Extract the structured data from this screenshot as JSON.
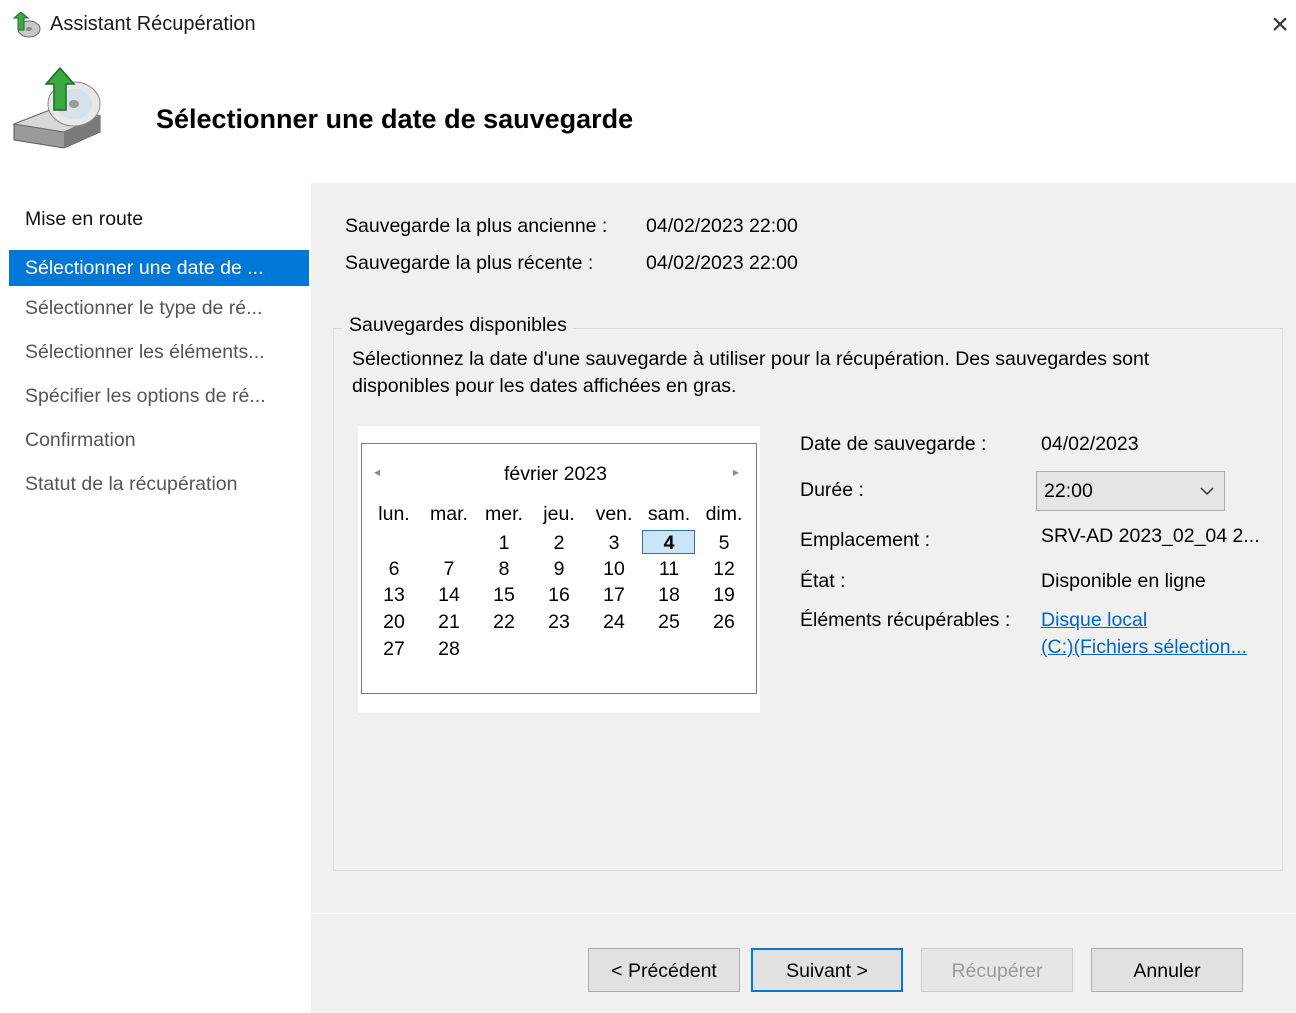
{
  "window": {
    "title": "Assistant Récupération",
    "close_glyph": "×"
  },
  "header": {
    "title": "Sélectionner une date de sauvegarde",
    "icon": "backup-disk-icon"
  },
  "sidebar": {
    "items": [
      {
        "label": "Mise en route"
      },
      {
        "label": "Sélectionner une date de ..."
      },
      {
        "label": "Sélectionner le type de ré..."
      },
      {
        "label": "Sélectionner les éléments..."
      },
      {
        "label": "Spécifier les options de ré..."
      },
      {
        "label": "Confirmation"
      },
      {
        "label": "Statut de la récupération"
      }
    ],
    "active_index": 1
  },
  "summary": {
    "oldest_label": "Sauvegarde la plus ancienne :",
    "oldest_value": "04/02/2023 22:00",
    "newest_label": "Sauvegarde la plus récente :",
    "newest_value": "04/02/2023 22:00"
  },
  "available": {
    "group_title": "Sauvegardes disponibles",
    "description": "Sélectionnez la date d'une sauvegarde à utiliser pour la récupération. Des sauvegardes sont disponibles pour les dates affichées en gras."
  },
  "calendar": {
    "month_label": "février 2023",
    "prev_glyph": "◂",
    "next_glyph": "▸",
    "weekdays": [
      "lun.",
      "mar.",
      "mer.",
      "jeu.",
      "ven.",
      "sam.",
      "dim."
    ],
    "weeks": [
      [
        "",
        "",
        "1",
        "2",
        "3",
        "4",
        "5"
      ],
      [
        "6",
        "7",
        "8",
        "9",
        "10",
        "11",
        "12"
      ],
      [
        "13",
        "14",
        "15",
        "16",
        "17",
        "18",
        "19"
      ],
      [
        "20",
        "21",
        "22",
        "23",
        "24",
        "25",
        "26"
      ],
      [
        "27",
        "28",
        "",
        "",
        "",
        "",
        ""
      ]
    ],
    "selected_day": "4",
    "bold_days": [
      "4"
    ]
  },
  "details": {
    "date_label": "Date de sauvegarde :",
    "date_value": "04/02/2023",
    "time_label": "Durée :",
    "time_value": "22:00",
    "location_label": "Emplacement :",
    "location_value": "SRV-AD 2023_02_04 2...",
    "state_label": "État :",
    "state_value": "Disponible en ligne",
    "items_label": "Éléments récupérables :",
    "items_link_line1": "Disque local ",
    "items_link_line2": "(C:)(Fichiers sélection..."
  },
  "buttons": {
    "previous": "< Précédent",
    "next": "Suivant >",
    "recover": "Récupérer",
    "cancel": "Annuler"
  },
  "colors": {
    "accent": "#0078d7",
    "link": "#0066cc",
    "panel_bg": "#f0f0f0"
  }
}
